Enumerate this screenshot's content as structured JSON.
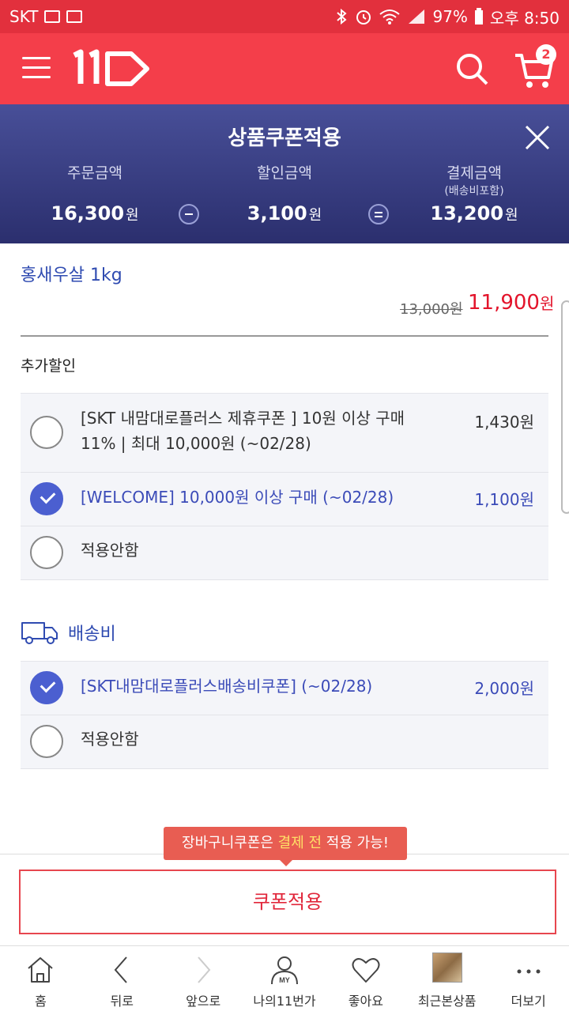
{
  "status_bar": {
    "carrier": "SKT",
    "battery": "97%",
    "time": "오후 8:50"
  },
  "header": {
    "cart_count": "2"
  },
  "summary": {
    "title": "상품쿠폰적용",
    "order_label": "주문금액",
    "order_amount": "16,300",
    "discount_label": "할인금액",
    "discount_amount": "3,100",
    "pay_label": "결제금액",
    "pay_sub": "(배송비포함)",
    "pay_amount": "13,200",
    "won": "원"
  },
  "product": {
    "name": "홍새우살 1kg",
    "original_price": "13,000원",
    "sale_price": "11,900",
    "won": "원"
  },
  "extra_discount": {
    "label": "추가할인",
    "options": [
      {
        "line1": "[SKT 내맘대로플러스 제휴쿠폰 ] 10원 이상 구매",
        "line2": "11% | 최대 10,000원 (~02/28)",
        "amount": "1,430원",
        "checked": false
      },
      {
        "line1": "[WELCOME] 10,000원 이상 구매 (~02/28)",
        "amount": "1,100원",
        "checked": true
      },
      {
        "line1": "적용안함",
        "checked": false
      }
    ]
  },
  "shipping": {
    "label": "배송비",
    "options": [
      {
        "line1": "[SKT내맘대로플러스배송비쿠폰] (~02/28)",
        "amount": "2,000원",
        "checked": true
      },
      {
        "line1": "적용안함",
        "checked": false
      }
    ]
  },
  "tooltip": {
    "part1": "장바구니쿠폰은 ",
    "highlight": "결제 전",
    "part2": " 적용 가능!"
  },
  "apply_button": "쿠폰적용",
  "nav": {
    "home": "홈",
    "back": "뒤로",
    "forward": "앞으로",
    "my": "나의11번가",
    "my_icon_text": "MY",
    "like": "좋아요",
    "recent": "최근본상품",
    "more": "더보기"
  }
}
